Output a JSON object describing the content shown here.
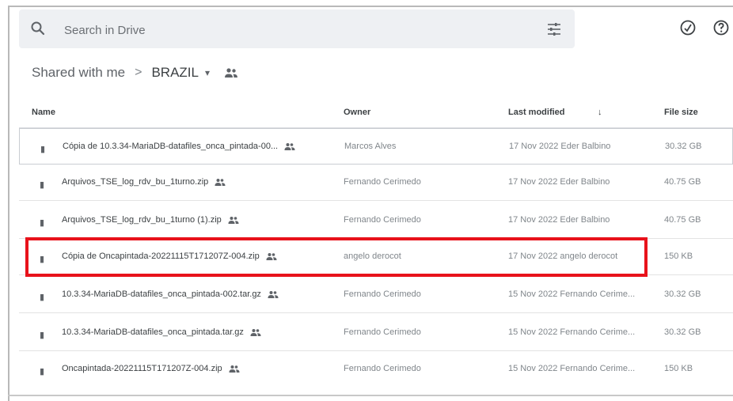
{
  "search": {
    "placeholder": "Search in Drive"
  },
  "icons": {
    "search": "search-icon",
    "filter": "tune-icon",
    "status": "offline-status-icon",
    "help": "help-icon",
    "shared": "shared-people-icon",
    "file": "zip-file-icon"
  },
  "breadcrumb": {
    "parent": "Shared with me",
    "separator": ">",
    "current": "BRAZIL",
    "caret": "▾"
  },
  "columns": {
    "name": "Name",
    "owner": "Owner",
    "modified": "Last modified",
    "sort_arrow": "↓",
    "size": "File size"
  },
  "files": [
    {
      "name": "Cópia de 10.3.34-MariaDB-datafiles_onca_pintada-00...",
      "owner": "Marcos Alves",
      "modified": "17 Nov 2022 Eder Balbino",
      "size": "30.32 GB"
    },
    {
      "name": "Arquivos_TSE_log_rdv_bu_1turno.zip",
      "owner": "Fernando Cerimedo",
      "modified": "17 Nov 2022 Eder Balbino",
      "size": "40.75 GB"
    },
    {
      "name": "Arquivos_TSE_log_rdv_bu_1turno (1).zip",
      "owner": "Fernando Cerimedo",
      "modified": "17 Nov 2022 Eder Balbino",
      "size": "40.75 GB"
    },
    {
      "name": "Cópia de Oncapintada-20221115T171207Z-004.zip",
      "owner": "angelo derocot",
      "modified": "17 Nov 2022 angelo derocot",
      "size": "150 KB"
    },
    {
      "name": "10.3.34-MariaDB-datafiles_onca_pintada-002.tar.gz",
      "owner": "Fernando Cerimedo",
      "modified": "15 Nov 2022 Fernando Cerime...",
      "size": "30.32 GB"
    },
    {
      "name": "10.3.34-MariaDB-datafiles_onca_pintada.tar.gz",
      "owner": "Fernando Cerimedo",
      "modified": "15 Nov 2022 Fernando Cerime...",
      "size": "30.32 GB"
    },
    {
      "name": "Oncapintada-20221115T171207Z-004.zip",
      "owner": "Fernando Cerimedo",
      "modified": "15 Nov 2022 Fernando Cerime...",
      "size": "150 KB"
    }
  ],
  "colors": {
    "highlight": "#e8121b",
    "search_bg": "#eef0f3",
    "divider": "#dadce0"
  }
}
